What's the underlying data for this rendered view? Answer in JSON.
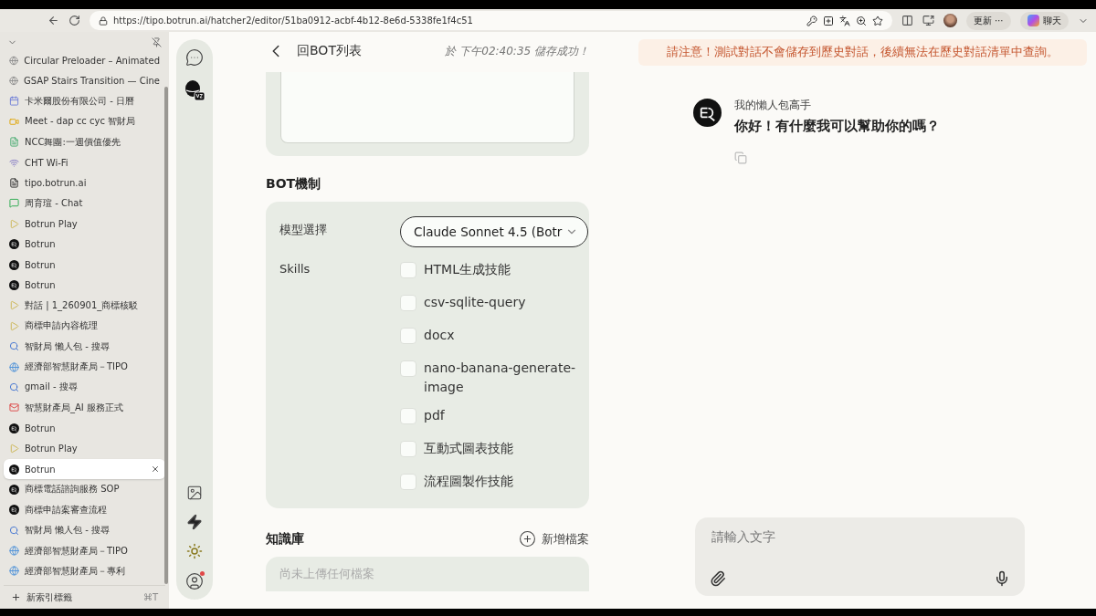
{
  "browser": {
    "url": "https://tipo.botrun.ai/hatcher2/editor/51ba0912-acbf-4b12-8e6d-5338fe1f4c51",
    "update_button": "更新",
    "more": "⋯",
    "chat_button": "聊天"
  },
  "tabs": [
    {
      "title": "Circular Preloader – Animated",
      "kind": "globe",
      "selected": false
    },
    {
      "title": "GSAP Stairs Transition — Cine",
      "kind": "globe",
      "selected": false
    },
    {
      "title": "卡米爾股份有限公司 - 日曆",
      "kind": "calendar",
      "selected": false
    },
    {
      "title": "Meet - dap cc cyc 智財局",
      "kind": "meet",
      "selected": false
    },
    {
      "title": "NCC舞團:一週價值優先",
      "kind": "sheet",
      "selected": false
    },
    {
      "title": "CHT Wi-Fi",
      "kind": "wifi",
      "selected": false
    },
    {
      "title": "tipo.botrun.ai",
      "kind": "doc",
      "selected": false
    },
    {
      "title": "周育瑄 - Chat",
      "kind": "chat",
      "selected": false
    },
    {
      "title": "Botrun Play",
      "kind": "play",
      "selected": false
    },
    {
      "title": "Botrun",
      "kind": "bot",
      "selected": false
    },
    {
      "title": "Botrun",
      "kind": "bot",
      "selected": false
    },
    {
      "title": "Botrun",
      "kind": "bot",
      "selected": false
    },
    {
      "title": "對話 | 1_260901_商標核駁",
      "kind": "play",
      "selected": false
    },
    {
      "title": "商標申請內容梳理",
      "kind": "play",
      "selected": false
    },
    {
      "title": "智財局 懶人包 - 搜尋",
      "kind": "search",
      "selected": false
    },
    {
      "title": "經濟部智慧財產局－TIPO",
      "kind": "tipo",
      "selected": false
    },
    {
      "title": "gmail - 搜尋",
      "kind": "search",
      "selected": false
    },
    {
      "title": "智慧財產局_AI 服務正式",
      "kind": "gmail",
      "selected": false
    },
    {
      "title": "Botrun",
      "kind": "bot",
      "selected": false
    },
    {
      "title": "Botrun Play",
      "kind": "play",
      "selected": false
    },
    {
      "title": "Botrun",
      "kind": "bot",
      "selected": true
    },
    {
      "title": "商標電話諮詢服務 SOP",
      "kind": "bot",
      "selected": false
    },
    {
      "title": "商標申請案審查流程",
      "kind": "bot",
      "selected": false
    },
    {
      "title": "智財局 懶人包 - 搜尋",
      "kind": "search",
      "selected": false
    },
    {
      "title": "經濟部智慧財產局－TIPO",
      "kind": "tipo",
      "selected": false
    },
    {
      "title": "經濟部智慧財產局－專利",
      "kind": "tipo",
      "selected": false
    }
  ],
  "new_tab": {
    "label": "新索引標籤",
    "shortcut": "⌘T"
  },
  "editor": {
    "back_label": "回BOT列表",
    "save_status": "於 下午02:40:35 儲存成功！",
    "section_title": "BOT機制",
    "model_label": "模型選擇",
    "model_value": "Claude Sonnet 4.5 (Botr",
    "skills_label": "Skills",
    "skills": [
      {
        "label": "HTML生成技能",
        "checked": false
      },
      {
        "label": "csv-sqlite-query",
        "checked": false
      },
      {
        "label": "docx",
        "checked": false
      },
      {
        "label": "nano-banana-generate-image",
        "checked": false
      },
      {
        "label": "pdf",
        "checked": false
      },
      {
        "label": "互動式圖表技能",
        "checked": false
      },
      {
        "label": "流程圖製作技能",
        "checked": false
      }
    ],
    "knowledge_title": "知識庫",
    "add_file": "新增檔案",
    "empty_text": "尚未上傳任何檔案"
  },
  "chat": {
    "notice": "請注意！測試對話不會儲存到歷史對話，後續無法在歷史對話清單中查詢。",
    "bot_name": "我的懶人包高手",
    "message": "你好！有什麼我可以幫助你的嗎？",
    "input_placeholder": "請輸入文字"
  }
}
